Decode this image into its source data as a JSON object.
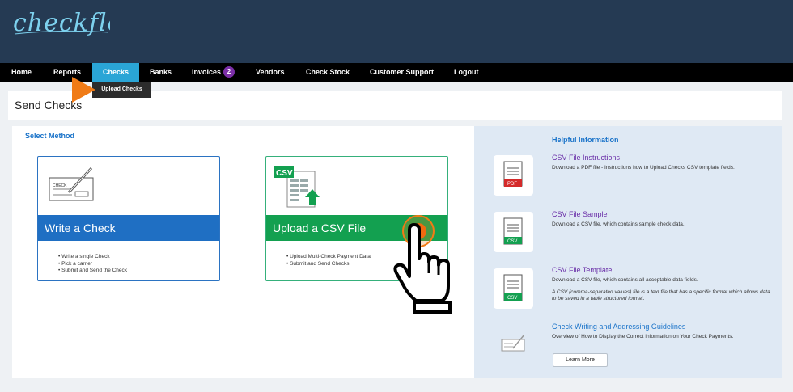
{
  "header": {
    "logo_text": "checkflo"
  },
  "nav": {
    "items": [
      "Home",
      "Reports",
      "Checks",
      "Banks",
      "Invoices",
      "Vendors",
      "Check Stock",
      "Customer Support",
      "Logout"
    ],
    "invoices_badge": "2",
    "active": "Checks"
  },
  "submenu": {
    "label": "Upload Checks"
  },
  "page": {
    "title": "Send Checks"
  },
  "main": {
    "select_method_label": "Select Method",
    "cards": [
      {
        "title": "Write a Check",
        "check_label": "CHECK",
        "bullets": [
          "Write a single Check",
          "Pick a carrier",
          "Submit and Send the Check"
        ]
      },
      {
        "title": "Upload a CSV File",
        "icon_label": "CSV",
        "bullets": [
          "Upload Multi-Check Payment Data",
          "Submit and Send Checks"
        ]
      }
    ]
  },
  "help": {
    "heading": "Helpful Information",
    "items": [
      {
        "title": "CSV File Instructions",
        "desc": "Download a PDF file - Instructions how to Upload Checks CSV template fields.",
        "icon_label": "PDF"
      },
      {
        "title": "CSV File Sample",
        "desc": "Download a CSV file, which contains sample check data.",
        "icon_label": "CSV"
      },
      {
        "title": "CSV File Template",
        "desc": "Download a CSV file, which contains all acceptable data fields.",
        "note": "A CSV (comma-separated values) file is a text file that has a specific format which allows data to be saved in a table structured format.",
        "icon_label": "CSV"
      },
      {
        "title": "Check Writing and Addressing Guidelines",
        "desc": "Overview of How to Display the Correct Information on Your Check Payments.",
        "button": "Learn More"
      }
    ]
  },
  "colors": {
    "header_bg": "#253a53",
    "nav_active": "#2aa5d6",
    "badge": "#7c2fa8",
    "write_band": "#1f6fc3",
    "csv_band": "#13a050",
    "pointer_orange": "#f06a10",
    "link_blue": "#1a73c9",
    "link_purple": "#6a2fa8"
  }
}
